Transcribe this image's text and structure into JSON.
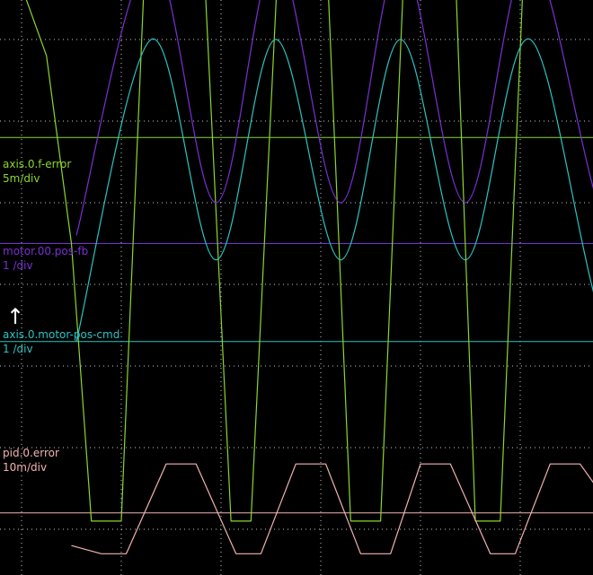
{
  "chart_data": {
    "type": "line",
    "grid": true,
    "background": "#000000",
    "grid_color": "#c8c8c8",
    "series": [
      {
        "name": "axis.0.f-error",
        "scale": "5m/div",
        "color": "#8cd62c",
        "baseline_level": 4.8,
        "values": [
          [
            0.0,
            6.65
          ],
          [
            0.25,
            5.8
          ],
          [
            0.5,
            3.5
          ],
          [
            0.7,
            0.1
          ],
          [
            1.0,
            0.1
          ],
          [
            1.35,
            10.2
          ],
          [
            1.7,
            10.2
          ],
          [
            2.1,
            0.1
          ],
          [
            2.3,
            0.1
          ],
          [
            2.7,
            10.2
          ],
          [
            2.95,
            10.2
          ],
          [
            3.3,
            0.1
          ],
          [
            3.6,
            0.1
          ],
          [
            3.95,
            10.2
          ],
          [
            4.25,
            10.2
          ],
          [
            4.55,
            0.1
          ],
          [
            4.8,
            0.1
          ],
          [
            5.15,
            10.2
          ],
          [
            5.5,
            10.2
          ],
          [
            5.95,
            4.8
          ],
          [
            6.75,
            4.8
          ]
        ]
      },
      {
        "name": "motor.00.pos-fb",
        "scale": "1 /div",
        "color": "#7b2fd6",
        "baseline_level": 3.5,
        "values": [
          [
            0.55,
            3.6
          ],
          [
            1.3,
            7.0
          ],
          [
            1.95,
            4.0
          ],
          [
            2.55,
            7.0
          ],
          [
            3.2,
            4.0
          ],
          [
            3.8,
            7.0
          ],
          [
            4.45,
            4.0
          ],
          [
            5.1,
            7.0
          ],
          [
            5.9,
            3.6
          ],
          [
            6.75,
            3.5
          ]
        ]
      },
      {
        "name": "axis.0.motor-pos-cmd",
        "scale": "1 /div",
        "color": "#2bc3c3",
        "baseline_level": 2.3,
        "values": [
          [
            0.55,
            2.3
          ],
          [
            1.3,
            6.0
          ],
          [
            1.95,
            3.3
          ],
          [
            2.55,
            6.0
          ],
          [
            3.2,
            3.3
          ],
          [
            3.8,
            6.0
          ],
          [
            4.45,
            3.3
          ],
          [
            5.1,
            6.0
          ],
          [
            5.9,
            2.3
          ],
          [
            6.75,
            2.3
          ]
        ]
      },
      {
        "name": "pid.0.error",
        "scale": "10m/div",
        "color": "#f3b3b3",
        "baseline_level": 0.2,
        "values": [
          [
            0.5,
            -0.2
          ],
          [
            0.8,
            -0.3
          ],
          [
            1.05,
            -0.3
          ],
          [
            1.45,
            0.8
          ],
          [
            1.75,
            0.8
          ],
          [
            2.15,
            -0.3
          ],
          [
            2.4,
            -0.3
          ],
          [
            2.75,
            0.8
          ],
          [
            3.05,
            0.8
          ],
          [
            3.4,
            -0.3
          ],
          [
            3.7,
            -0.3
          ],
          [
            4.0,
            0.8
          ],
          [
            4.3,
            0.8
          ],
          [
            4.7,
            -0.3
          ],
          [
            4.95,
            -0.3
          ],
          [
            5.3,
            0.8
          ],
          [
            5.6,
            0.8
          ],
          [
            5.95,
            0.2
          ],
          [
            6.75,
            0.2
          ]
        ]
      }
    ]
  },
  "trigger_marker": "↑"
}
